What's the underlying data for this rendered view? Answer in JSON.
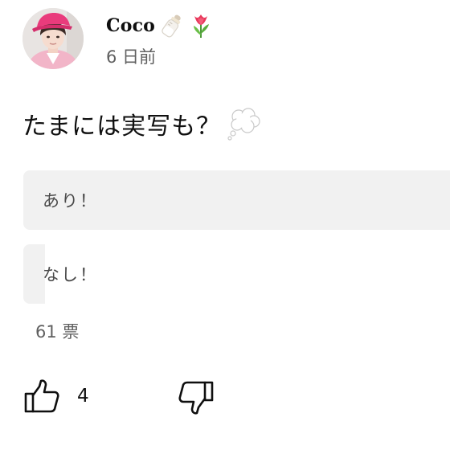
{
  "post": {
    "author": "Coco",
    "author_badges": [
      "baby-bottle-icon",
      "tulip-icon"
    ],
    "timestamp": "6 日前",
    "text": "たまには実写も？",
    "text_emoji": "thought-balloon-icon"
  },
  "poll": {
    "options": [
      {
        "label": "あり！",
        "share": 1.0
      },
      {
        "label": "なし！",
        "share": 0.05
      }
    ],
    "votes_label": "61 票"
  },
  "actions": {
    "like_count": "4",
    "like_icon": "thumbs-up-icon",
    "dislike_icon": "thumbs-down-icon"
  },
  "colors": {
    "poll_fill": "#f1f1f1",
    "secondary_text": "#606060",
    "primary_text": "#0f0f0f"
  }
}
